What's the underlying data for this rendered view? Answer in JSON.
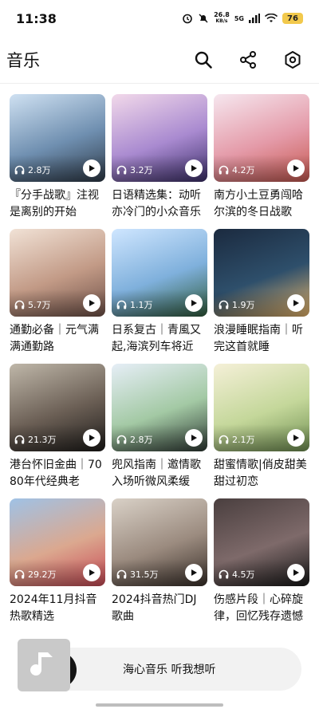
{
  "status_bar": {
    "time": "11:38",
    "net_speed_value": "26.8",
    "net_speed_unit": "KB/s",
    "signal_label": "5G",
    "battery": "76"
  },
  "app": {
    "title": "音乐",
    "icons": [
      "search-icon",
      "share-icon",
      "settings-icon"
    ]
  },
  "playlists": [
    {
      "title": "『分手战歌』注视是离别的开始",
      "plays": "2.8万",
      "cover_colors": [
        "#cfe1f2",
        "#6f8fb0",
        "#2e3a48"
      ]
    },
    {
      "title": "日语精选集：动听亦冷门的小众音乐",
      "plays": "3.2万",
      "cover_colors": [
        "#f2d9ea",
        "#a98ad0",
        "#3c2f6a"
      ]
    },
    {
      "title": "南方小土豆勇闯哈尔滨的冬日战歌",
      "plays": "4.2万",
      "cover_colors": [
        "#f6e7ef",
        "#e49aa8",
        "#c6584f"
      ]
    },
    {
      "title": "通勤必备｜元气满满通勤路",
      "plays": "5.7万",
      "cover_colors": [
        "#f1e2d6",
        "#c29a86",
        "#6f5148"
      ]
    },
    {
      "title": "日系复古｜青風又起,海滨列车将近",
      "plays": "1.1万",
      "cover_colors": [
        "#cfe6ff",
        "#7fb0dc",
        "#2f5b3b"
      ]
    },
    {
      "title": "浪漫睡眠指南｜听完这首就睡",
      "plays": "1.9万",
      "cover_colors": [
        "#1b2a3f",
        "#2e4f6b",
        "#e7b56a"
      ]
    },
    {
      "title": "港台怀旧金曲｜7080年代经典老",
      "plays": "21.3万",
      "cover_colors": [
        "#bfb7a9",
        "#6b5f55",
        "#1e1c1a"
      ]
    },
    {
      "title": "兜风指南｜邀情歌入场听微风柔缓",
      "plays": "2.8万",
      "cover_colors": [
        "#e6eef7",
        "#a3c9a4",
        "#2f3b35"
      ]
    },
    {
      "title": "甜蜜情歌|俏皮甜美甜过初恋",
      "plays": "2.1万",
      "cover_colors": [
        "#f5f0d8",
        "#c4d79a",
        "#6f8f51"
      ]
    },
    {
      "title": "2024年11月抖音热歌精选",
      "plays": "29.2万",
      "cover_colors": [
        "#9fc2e6",
        "#dba88f",
        "#c94a56"
      ]
    },
    {
      "title": "2024抖音热门DJ歌曲",
      "plays": "31.5万",
      "cover_colors": [
        "#d9d1c7",
        "#9b8b7f",
        "#3a302a"
      ]
    },
    {
      "title": "伤感片段｜心碎旋律，回忆残存遗憾",
      "plays": "4.5万",
      "cover_colors": [
        "#4a3f3f",
        "#7e6a6a",
        "#181818"
      ]
    }
  ],
  "player": {
    "title": "海心音乐 听我想听",
    "art_icon": "music-note-icon"
  }
}
